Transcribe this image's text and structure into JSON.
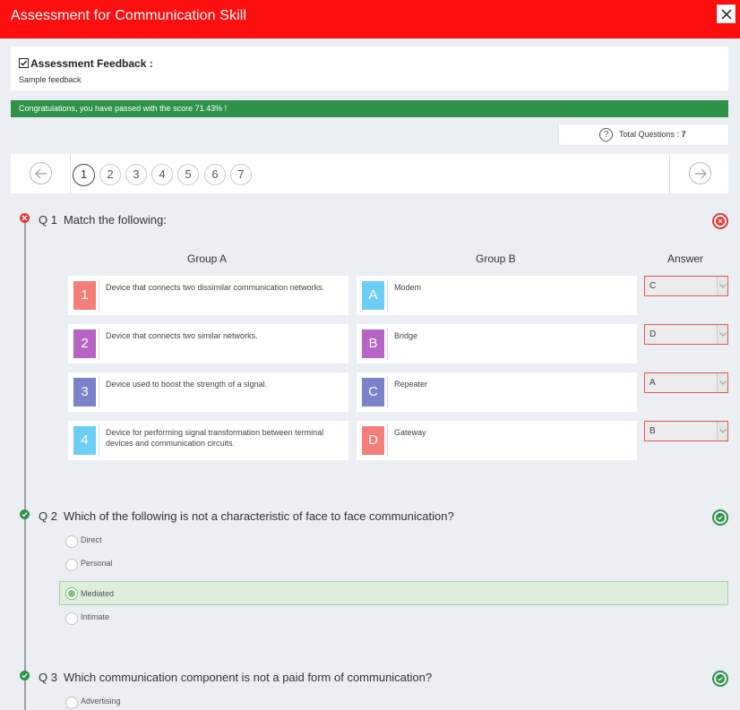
{
  "header": {
    "title": "Assessment for Communication Skill",
    "close_icon": "close-icon"
  },
  "feedback": {
    "title": "Assessment Feedback :",
    "text": "Sample feedback"
  },
  "result": {
    "message": "Congratulations, you have passed with the score 71.43% !",
    "color": "#2e9249"
  },
  "summary": {
    "label": "Total Questions :",
    "count": "7"
  },
  "pager": {
    "pages": [
      "1",
      "2",
      "3",
      "4",
      "5",
      "6",
      "7"
    ],
    "current": "1"
  },
  "questions": [
    {
      "number": "Q 1",
      "text": "Match the following:",
      "status": "wrong",
      "headers": {
        "group_a": "Group A",
        "group_b": "Group B",
        "answer": "Answer"
      },
      "group_a": [
        {
          "key": "1",
          "text": "Device that connects two dissimilar communication networks.",
          "color": "#f47f7a"
        },
        {
          "key": "2",
          "text": "Device that connects two similar networks.",
          "color": "#b565c4"
        },
        {
          "key": "3",
          "text": "Device used to boost the strength of a signal.",
          "color": "#7a83c7"
        },
        {
          "key": "4",
          "text": "Device for performing signal transformation between terminal devices and communication circuits.",
          "color": "#6ecdf4"
        }
      ],
      "group_b": [
        {
          "key": "A",
          "text": "Modem",
          "color": "#6ecdf4"
        },
        {
          "key": "B",
          "text": "Bridge",
          "color": "#b565c4"
        },
        {
          "key": "C",
          "text": "Repeater",
          "color": "#7a83c7"
        },
        {
          "key": "D",
          "text": "Gateway",
          "color": "#f47f7a"
        }
      ],
      "answers": [
        "C",
        "D",
        "A",
        "B"
      ]
    },
    {
      "number": "Q 2",
      "text": "Which of the following is not a characteristic of face to face communication?",
      "status": "right",
      "options": [
        "Direct",
        "Personal",
        "Mediated",
        "Intimate"
      ],
      "selected": "Mediated"
    },
    {
      "number": "Q 3",
      "text": "Which communication component is not a paid form of communication?",
      "status": "right",
      "options": [
        "Advertising"
      ]
    }
  ]
}
